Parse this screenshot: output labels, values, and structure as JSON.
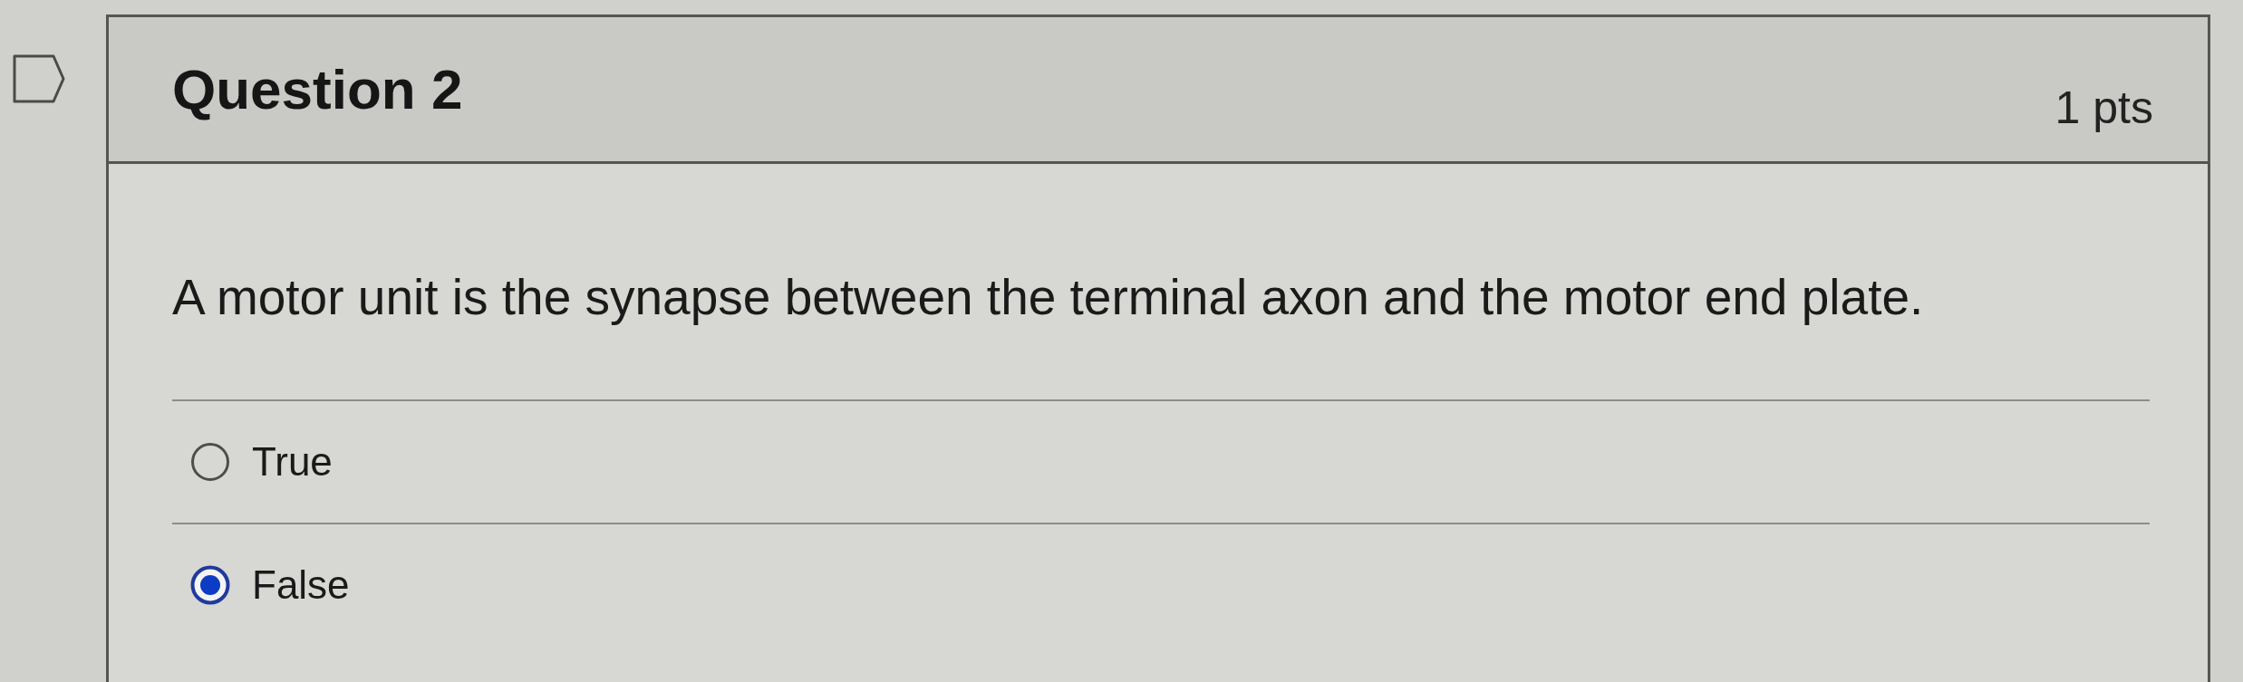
{
  "question": {
    "title": "Question 2",
    "points": "1 pts",
    "text": "A motor unit is the synapse between the terminal axon and the motor end plate."
  },
  "answers": [
    {
      "label": "True",
      "selected": false
    },
    {
      "label": "False",
      "selected": true
    }
  ]
}
